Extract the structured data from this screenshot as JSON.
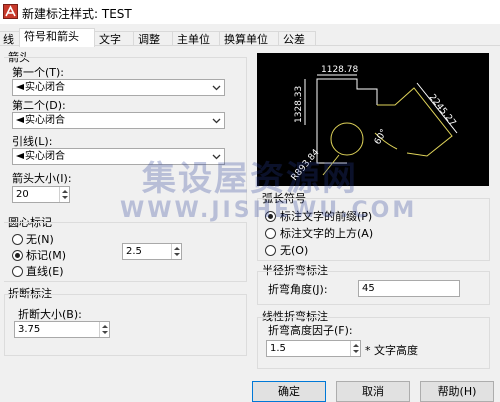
{
  "window": {
    "title": "新建标注样式: TEST"
  },
  "tabs": [
    "线",
    "符号和箭头",
    "文字",
    "调整",
    "主单位",
    "换算单位",
    "公差"
  ],
  "arrowheads": {
    "group_label": "箭头",
    "first_label": "第一个(T):",
    "first_value": "实心闭合",
    "second_label": "第二个(D):",
    "second_value": "实心闭合",
    "leader_label": "引线(L):",
    "leader_value": "实心闭合",
    "size_label": "箭头大小(I):",
    "size_value": "20"
  },
  "center_marks": {
    "group_label": "圆心标记",
    "options": [
      "无(N)",
      "标记(M)",
      "直线(E)"
    ],
    "selected": "标记(M)",
    "size_value": "2.5"
  },
  "break": {
    "group_label": "折断标注",
    "size_label": "折断大小(B):",
    "size_value": "3.75"
  },
  "preview": {
    "dims": [
      "1128.78",
      "1328.33",
      "2245.27",
      "60°",
      "R893.84"
    ]
  },
  "arc_length": {
    "group_label": "弧长符号",
    "options": [
      "标注文字的前缀(P)",
      "标注文字的上方(A)",
      "无(O)"
    ],
    "selected": "标注文字的前缀(P)"
  },
  "radius_jog": {
    "group_label": "半径折弯标注",
    "angle_label": "折弯角度(J):",
    "angle_value": "45"
  },
  "linear_jog": {
    "group_label": "线性折弯标注",
    "factor_label": "折弯高度因子(F):",
    "factor_value": "1.5",
    "factor_suffix": "* 文字高度"
  },
  "buttons": {
    "ok": "确定",
    "cancel": "取消",
    "help": "帮助(H)"
  },
  "watermark": {
    "line1": "集设屋资源网",
    "line2": "WWW.JISHEWU.COM"
  }
}
